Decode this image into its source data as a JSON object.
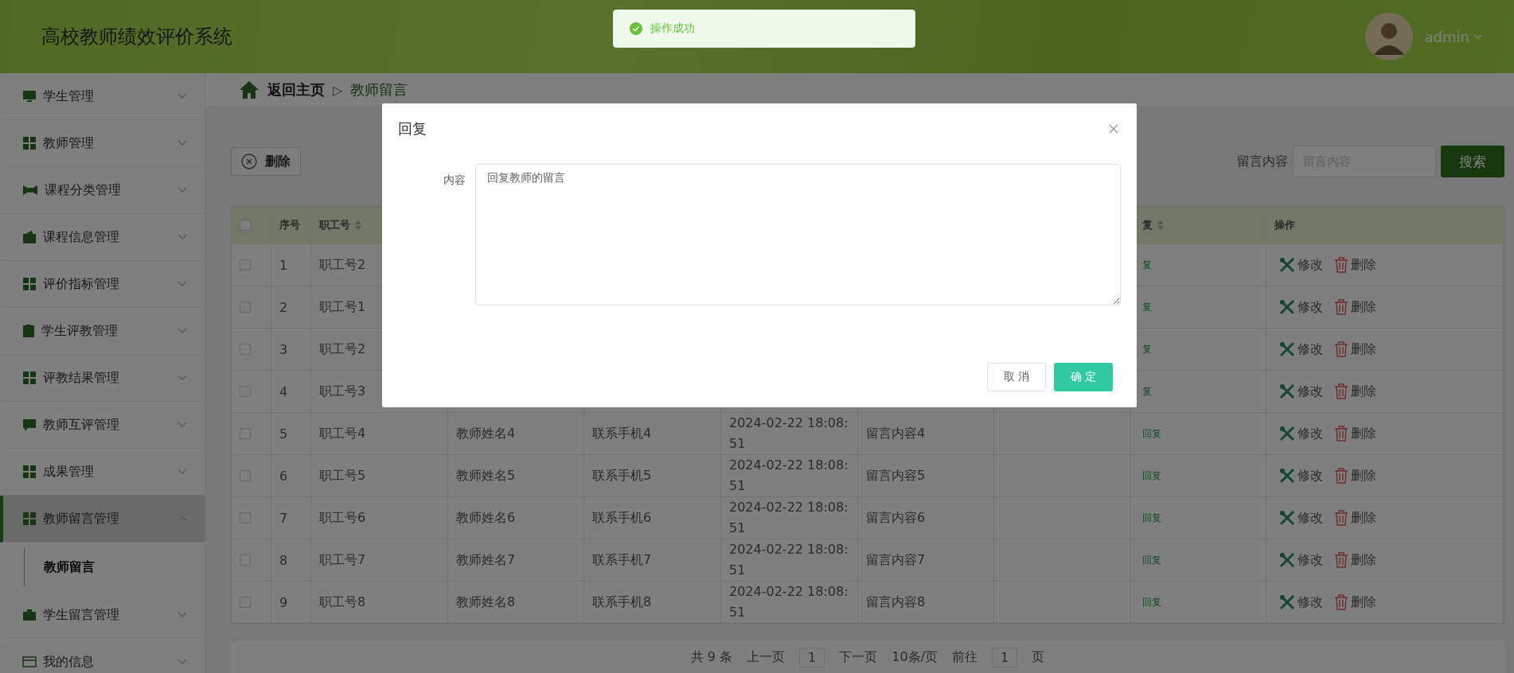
{
  "header": {
    "title": "高校教师绩效评价系统",
    "user": "admin"
  },
  "toast": {
    "kind": "success",
    "message": "操作成功"
  },
  "sidebar": {
    "items": [
      {
        "label": "学生管理",
        "expanded": false
      },
      {
        "label": "教师管理",
        "expanded": false
      },
      {
        "label": "课程分类管理",
        "expanded": false
      },
      {
        "label": "课程信息管理",
        "expanded": false
      },
      {
        "label": "评价指标管理",
        "expanded": false
      },
      {
        "label": "学生评教管理",
        "expanded": false
      },
      {
        "label": "评教结果管理",
        "expanded": false
      },
      {
        "label": "教师互评管理",
        "expanded": false
      },
      {
        "label": "成果管理",
        "expanded": false
      },
      {
        "label": "教师留言管理",
        "expanded": true,
        "children": [
          {
            "label": "教师留言",
            "selected": true
          }
        ]
      },
      {
        "label": "学生留言管理",
        "expanded": false
      },
      {
        "label": "我的信息",
        "expanded": false
      }
    ]
  },
  "breadcrumb": {
    "home": "返回主页",
    "separator": "▷",
    "current": "教师留言"
  },
  "toolbar": {
    "delete_button": "删除",
    "search_label": "留言内容",
    "search_placeholder": "留言内容",
    "search_button": "搜索"
  },
  "table": {
    "select_all": {
      "checked": false
    },
    "columns": {
      "index": "序号",
      "staff_id": "职工号",
      "reply": "复",
      "actions": "操作"
    },
    "rows": [
      {
        "checked": false,
        "index": "1",
        "staff_id": "职工号2",
        "reply": "复",
        "edit": "修改",
        "delete": "删除"
      },
      {
        "checked": false,
        "index": "2",
        "staff_id": "职工号1",
        "reply": "复",
        "edit": "修改",
        "delete": "删除"
      },
      {
        "checked": false,
        "index": "3",
        "staff_id": "职工号2",
        "reply": "复",
        "edit": "修改",
        "delete": "删除"
      },
      {
        "checked": false,
        "index": "4",
        "staff_id": "职工号3",
        "reply": "复",
        "edit": "修改",
        "delete": "删除"
      },
      {
        "checked": false,
        "index": "5",
        "staff_id": "职工号4",
        "name": "教师姓名4",
        "phone": "联系手机4",
        "time": "2024-02-22 18:08:51",
        "content": "留言内容4",
        "reply": "回复",
        "edit": "修改",
        "delete": "删除"
      },
      {
        "checked": false,
        "index": "6",
        "staff_id": "职工号5",
        "name": "教师姓名5",
        "phone": "联系手机5",
        "time": "2024-02-22 18:08:51",
        "content": "留言内容5",
        "reply": "回复",
        "edit": "修改",
        "delete": "删除"
      },
      {
        "checked": false,
        "index": "7",
        "staff_id": "职工号6",
        "name": "教师姓名6",
        "phone": "联系手机6",
        "time": "2024-02-22 18:08:51",
        "content": "留言内容6",
        "reply": "回复",
        "edit": "修改",
        "delete": "删除"
      },
      {
        "checked": false,
        "index": "8",
        "staff_id": "职工号7",
        "name": "教师姓名7",
        "phone": "联系手机7",
        "time": "2024-02-22 18:08:51",
        "content": "留言内容7",
        "reply": "回复",
        "edit": "修改",
        "delete": "删除"
      },
      {
        "checked": false,
        "index": "9",
        "staff_id": "职工号8",
        "name": "教师姓名8",
        "phone": "联系手机8",
        "time": "2024-02-22 18:08:51",
        "content": "留言内容8",
        "reply": "回复",
        "edit": "修改",
        "delete": "删除"
      }
    ]
  },
  "pagination": {
    "total": "共 9 条",
    "prev": "上一页",
    "page": "1",
    "next": "下一页",
    "page_size": "10条/页",
    "goto": "前往",
    "goto_value": "1",
    "page_suffix": "页"
  },
  "dialog": {
    "title": "回复",
    "label": "内容",
    "value": "回复教师的留言",
    "cancel": "取 消",
    "confirm": "确 定"
  }
}
